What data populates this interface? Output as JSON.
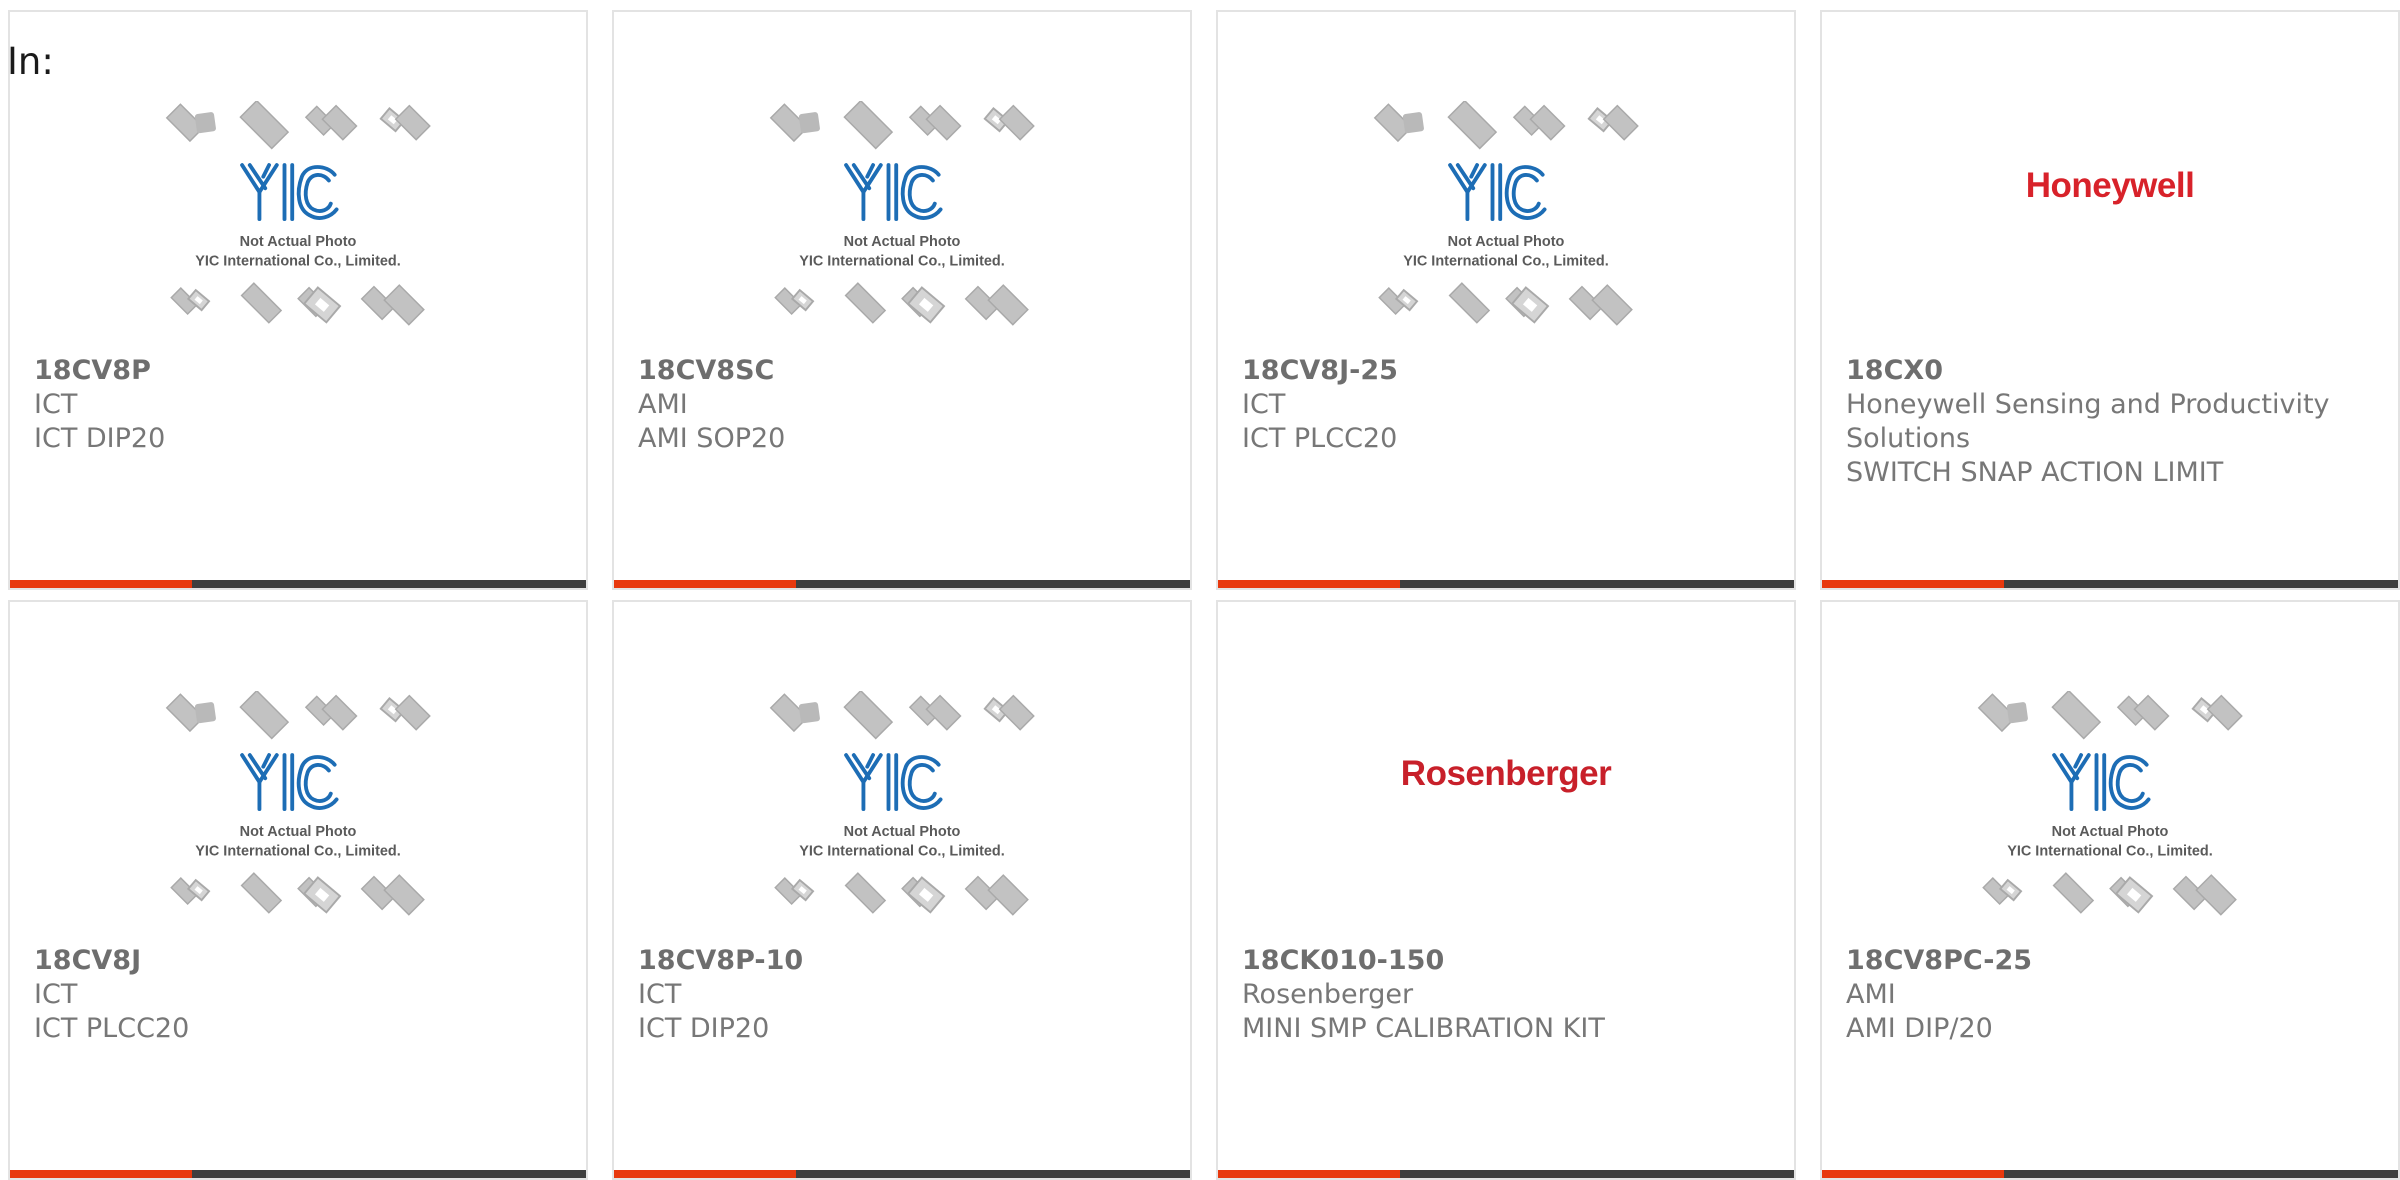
{
  "header": {
    "label": "In:"
  },
  "colors": {
    "accent_bar": "#e8380d",
    "base_bar": "#3f3f3f",
    "honeywell_red": "#d8222a",
    "rosenberger_red": "#c8202a",
    "yic_blue": "#1d6db5"
  },
  "placeholder_image": {
    "logo_text": "YIC",
    "line1": "Not Actual Photo",
    "line2": "YIC International Co., Limited."
  },
  "products": [
    {
      "part_number": "18CV8P",
      "manufacturer": "ICT",
      "description": "ICT DIP20",
      "image": "yic-placeholder"
    },
    {
      "part_number": "18CV8SC",
      "manufacturer": "AMI",
      "description": "AMI SOP20",
      "image": "yic-placeholder"
    },
    {
      "part_number": "18CV8J-25",
      "manufacturer": "ICT",
      "description": "ICT PLCC20",
      "image": "yic-placeholder"
    },
    {
      "part_number": "18CX0",
      "manufacturer": "Honeywell Sensing and Productivity Solutions",
      "description": "SWITCH SNAP ACTION LIMIT",
      "image": "honeywell-logo",
      "logo_text": "Honeywell"
    },
    {
      "part_number": "18CV8J",
      "manufacturer": "ICT",
      "description": "ICT PLCC20",
      "image": "yic-placeholder"
    },
    {
      "part_number": "18CV8P-10",
      "manufacturer": "ICT",
      "description": "ICT DIP20",
      "image": "yic-placeholder"
    },
    {
      "part_number": "18CK010-150",
      "manufacturer": "Rosenberger",
      "description": "MINI SMP CALIBRATION KIT",
      "image": "rosenberger-logo",
      "logo_text": "Rosenberger"
    },
    {
      "part_number": "18CV8PC-25",
      "manufacturer": "AMI",
      "description": "AMI DIP/20",
      "image": "yic-placeholder"
    }
  ]
}
